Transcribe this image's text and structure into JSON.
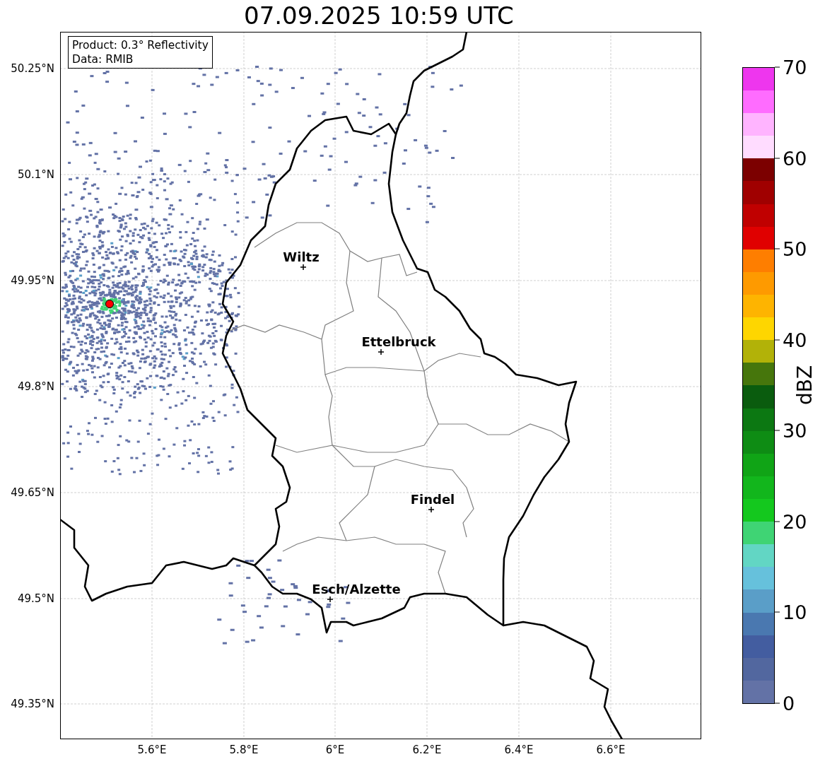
{
  "title": "07.09.2025 10:59 UTC",
  "legend": [
    "Product: 0.3° Reflectivity",
    "Data: RMIB"
  ],
  "map": {
    "y_ticks": [
      "50.25°N",
      "50.1°N",
      "49.95°N",
      "49.8°N",
      "49.65°N",
      "49.5°N",
      "49.35°N"
    ],
    "x_ticks": [
      "5.6°E",
      "5.8°E",
      "6°E",
      "6.2°E",
      "6.4°E",
      "6.6°E"
    ],
    "cities": [
      {
        "name": "Wiltz"
      },
      {
        "name": "Ettelbruck"
      },
      {
        "name": "Findel"
      },
      {
        "name": "Esch/Alzette"
      }
    ]
  },
  "colorbar": {
    "label": "dBZ",
    "ticks": [
      "70",
      "60",
      "50",
      "40",
      "30",
      "20",
      "10",
      "0"
    ],
    "bins": [
      {
        "color": "#6372a6"
      },
      {
        "color": "#52679f"
      },
      {
        "color": "#435da0"
      },
      {
        "color": "#4a78b0"
      },
      {
        "color": "#5a9ec8"
      },
      {
        "color": "#66c1dc"
      },
      {
        "color": "#62d6c4"
      },
      {
        "color": "#3fd474"
      },
      {
        "color": "#14c81e"
      },
      {
        "color": "#12b61c"
      },
      {
        "color": "#10a416"
      },
      {
        "color": "#0e8c14"
      },
      {
        "color": "#0c7812"
      },
      {
        "color": "#0a5c0e"
      },
      {
        "color": "#46760c"
      },
      {
        "color": "#b2b208"
      },
      {
        "color": "#fed600"
      },
      {
        "color": "#feb400"
      },
      {
        "color": "#fe9a00"
      },
      {
        "color": "#fe7e00"
      },
      {
        "color": "#e00000"
      },
      {
        "color": "#c00000"
      },
      {
        "color": "#a00000"
      },
      {
        "color": "#7c0000"
      },
      {
        "color": "#ffdcff"
      },
      {
        "color": "#ffb4ff"
      },
      {
        "color": "#ff6cff"
      },
      {
        "color": "#ee36ee"
      }
    ]
  }
}
